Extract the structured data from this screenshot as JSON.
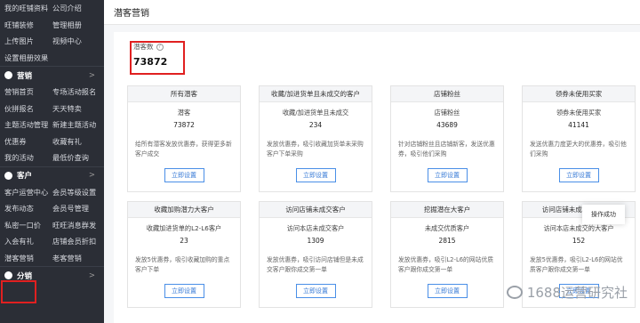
{
  "sidebar": {
    "rows_top": [
      [
        "我的旺铺资料",
        "公司介绍"
      ],
      [
        "旺铺装修",
        "管理相册"
      ],
      [
        "上传图片",
        "视频中心"
      ],
      [
        "设置相册效果",
        ""
      ]
    ],
    "section_marketing": "营销",
    "rows_marketing": [
      [
        "营销首页",
        "专场活动报名"
      ],
      [
        "伙拼报名",
        "天天特卖"
      ],
      [
        "主题活动管理",
        "新建主题活动"
      ],
      [
        "优惠券",
        "收藏有礼"
      ],
      [
        "我的活动",
        "最低价查询"
      ]
    ],
    "section_customer": "客户",
    "rows_customer": [
      [
        "客户运营中心",
        "会员等级设置"
      ],
      [
        "发布动态",
        "会员号管理"
      ],
      [
        "私密一口价",
        "旺旺消息群发"
      ],
      [
        "入会有礼",
        "店铺会员折扣"
      ],
      [
        "潜客营销",
        "老客营销"
      ]
    ],
    "section_share": "分销",
    "chevron": ">"
  },
  "page": {
    "title": "潜客营销",
    "total_label": "潜客数",
    "total_value": "73872",
    "toast": "操作成功",
    "watermark": "1688运营研究社"
  },
  "cards": [
    {
      "title": "所有潜客",
      "metric_label": "潜客",
      "metric_value": "73872",
      "desc": "给所有潜客发放优惠券，获得更多新客户成交",
      "button": "立即设置"
    },
    {
      "title": "收藏/加进货单且未成交的客户",
      "metric_label": "收藏/加进货单且未成交",
      "metric_value": "234",
      "desc": "发放优惠券，吸引收藏加货单未采购客户下单采购",
      "button": "立即设置"
    },
    {
      "title": "店铺粉丝",
      "metric_label": "店铺粉丝",
      "metric_value": "43689",
      "desc": "针对店铺粉丝且店铺新客，发送优惠券，吸引他们采购",
      "button": "立即设置"
    },
    {
      "title": "领券未使用买家",
      "metric_label": "领券未使用买家",
      "metric_value": "41141",
      "desc": "发送优惠力度更大的优惠券，吸引他们采购",
      "button": "立即设置"
    },
    {
      "title": "收藏加购潜力大客户",
      "metric_label": "收藏加进货单的L2-L6客户",
      "metric_value": "23",
      "desc": "发放5优惠券，吸引收藏加购的重点客户下单",
      "button": "立即设置"
    },
    {
      "title": "访问店铺未成交客户",
      "metric_label": "访问本店未成交客户",
      "metric_value": "1309",
      "desc": "发放优惠券，吸引访问店铺但是未成交客户跟你成交第一单",
      "button": "立即设置"
    },
    {
      "title": "挖掘潜在大客户",
      "metric_label": "未成交优质客户",
      "metric_value": "2815",
      "desc": "发放优惠券，吸引L2-L6的网站优质客户跟你成交第一单",
      "button": "立即设置"
    },
    {
      "title": "访问店铺未成交的大客户",
      "metric_label": "访问本店未成交的大客户",
      "metric_value": "152",
      "desc": "发放5优惠券，吸引L2-L6的网站优质客户跟你成交第一单",
      "button": "立即设置"
    }
  ]
}
